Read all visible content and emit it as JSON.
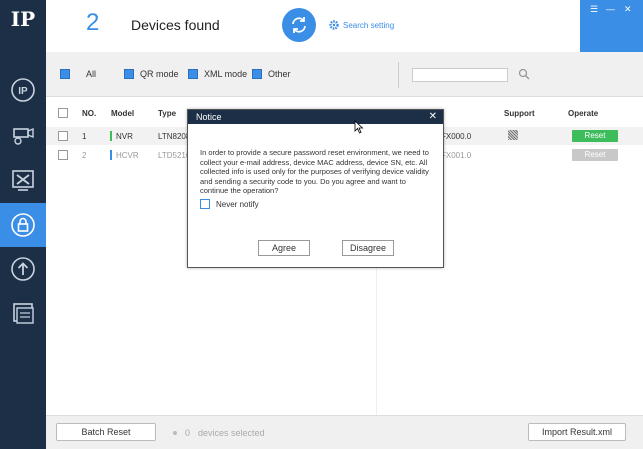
{
  "sidebar": {
    "logo": "IP",
    "items": [
      {
        "name": "ip-settings"
      },
      {
        "name": "camera-config"
      },
      {
        "name": "system-tools"
      },
      {
        "name": "password-reset"
      },
      {
        "name": "upgrade"
      },
      {
        "name": "device-list"
      }
    ]
  },
  "header": {
    "count": "2",
    "title": "Devices found",
    "search_setting": "Search setting"
  },
  "filters": {
    "all": "All",
    "qr": "QR mode",
    "xml": "XML mode",
    "other": "Other",
    "search_value": ""
  },
  "table": {
    "columns": {
      "no": "NO.",
      "model": "Model",
      "type": "Type",
      "support": "Support",
      "operate": "Operate"
    },
    "rows": [
      {
        "no": "1",
        "model": "NVR",
        "type": "LTN8208",
        "suffix": "FX000.0",
        "action": "Reset"
      },
      {
        "no": "2",
        "model": "HCVR",
        "type": "LTD5216",
        "suffix": "FX001.0",
        "action": "Reset"
      }
    ]
  },
  "footer": {
    "batch_reset": "Batch Reset",
    "selected_count": "0",
    "selected_label": "devices selected",
    "import": "Import Result.xml"
  },
  "modal": {
    "title": "Notice",
    "body": "In order to provide a secure password reset environment, we need to collect your e-mail address, device MAC address, device SN, etc. All collected info is used only for the purposes of verifying device validity and sending a security code to you. Do you agree and want to continue the operation?",
    "never_notify": "Never notify",
    "agree": "Agree",
    "disagree": "Disagree"
  },
  "colors": {
    "accent": "#3a8ee6",
    "sidebar": "#1c2f46",
    "reset_active": "#3cbc5a",
    "reset_disabled": "#c8c8c8",
    "model_nvr": "#3cbc5a",
    "model_hcvr": "#3a8ee6"
  }
}
